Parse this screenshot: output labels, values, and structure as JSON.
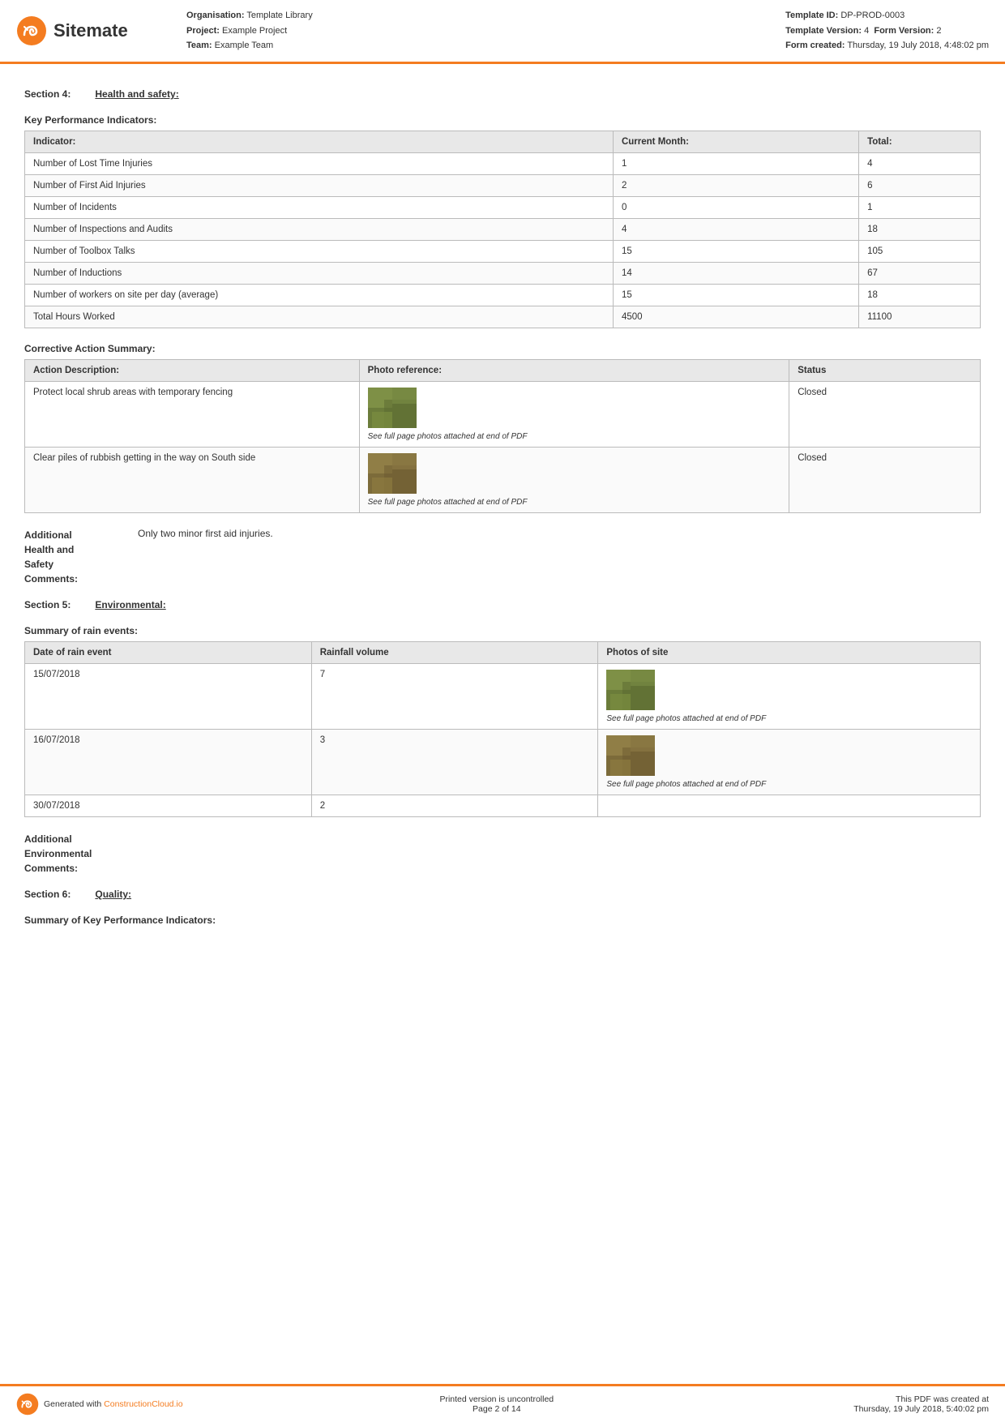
{
  "header": {
    "logo_text": "Sitemate",
    "org_label": "Organisation:",
    "org_value": "Template Library",
    "project_label": "Project:",
    "project_value": "Example Project",
    "team_label": "Team:",
    "team_value": "Example Team",
    "template_id_label": "Template ID:",
    "template_id_value": "DP-PROD-0003",
    "template_version_label": "Template Version:",
    "template_version_value": "4",
    "form_version_label": "Form Version:",
    "form_version_value": "2",
    "form_created_label": "Form created:",
    "form_created_value": "Thursday, 19 July 2018, 4:48:02 pm"
  },
  "section4": {
    "label": "Section 4:",
    "title": "Health and safety:"
  },
  "kpi_table": {
    "title": "Key Performance Indicators:",
    "headers": [
      "Indicator:",
      "Current Month:",
      "Total:"
    ],
    "rows": [
      [
        "Number of Lost Time Injuries",
        "1",
        "4"
      ],
      [
        "Number of First Aid Injuries",
        "2",
        "6"
      ],
      [
        "Number of Incidents",
        "0",
        "1"
      ],
      [
        "Number of Inspections and Audits",
        "4",
        "18"
      ],
      [
        "Number of Toolbox Talks",
        "15",
        "105"
      ],
      [
        "Number of Inductions",
        "14",
        "67"
      ],
      [
        "Number of workers on site per day (average)",
        "15",
        "18"
      ],
      [
        "Total Hours Worked",
        "4500",
        "11100"
      ]
    ]
  },
  "corrective_action": {
    "title": "Corrective Action Summary:",
    "headers": [
      "Action Description:",
      "Photo reference:",
      "Status"
    ],
    "rows": [
      {
        "description": "Protect local shrub areas with temporary fencing",
        "photo_caption": "See full page photos attached at end of PDF",
        "status": "Closed"
      },
      {
        "description": "Clear piles of rubbish getting in the way on South side",
        "photo_caption": "See full page photos attached at end of PDF",
        "status": "Closed"
      }
    ]
  },
  "comments_section": {
    "label": "Additional\nHealth and\nSafety\nComments:",
    "value": "Only two minor first aid injuries."
  },
  "section5": {
    "label": "Section 5:",
    "title": "Environmental:"
  },
  "rain_table": {
    "title": "Summary of rain events:",
    "headers": [
      "Date of rain event",
      "Rainfall volume",
      "Photos of site"
    ],
    "rows": [
      {
        "date": "15/07/2018",
        "volume": "7",
        "photo_caption": "See full page photos attached at end of PDF"
      },
      {
        "date": "16/07/2018",
        "volume": "3",
        "photo_caption": "See full page photos attached at end of PDF"
      },
      {
        "date": "30/07/2018",
        "volume": "2",
        "photo_caption": ""
      }
    ]
  },
  "env_comments": {
    "label": "Additional\nEnvironmental\nComments:",
    "value": ""
  },
  "section6": {
    "label": "Section 6:",
    "title": "Quality:"
  },
  "quality_kpi": {
    "title": "Summary of Key Performance Indicators:"
  },
  "footer": {
    "generated_text": "Generated with",
    "link_text": "ConstructionCloud.io",
    "uncontrolled": "Printed version is uncontrolled",
    "page_info": "Page 2 of 14",
    "pdf_created": "This PDF was created at",
    "pdf_date": "Thursday, 19 July 2018, 5:40:02 pm"
  }
}
